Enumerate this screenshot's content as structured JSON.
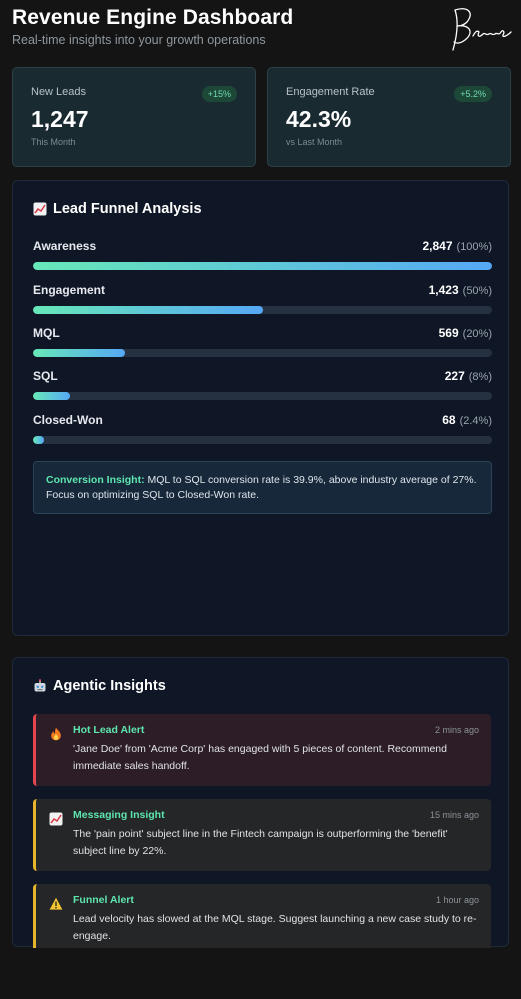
{
  "header": {
    "title": "Revenue Engine Dashboard",
    "subtitle": "Real-time insights into your growth operations",
    "signature": "Brand"
  },
  "kpis": [
    {
      "label": "New Leads",
      "value": "1,247",
      "caption": "This Month",
      "badge": "+15%"
    },
    {
      "label": "Engagement Rate",
      "value": "42.3%",
      "caption": "vs Last Month",
      "badge": "+5.2%"
    }
  ],
  "funnel": {
    "title": "Lead Funnel Analysis",
    "icon": "chart-icon",
    "stages": [
      {
        "name": "Awareness",
        "count": "2,847",
        "pct": "(100%)",
        "fill": 1.0
      },
      {
        "name": "Engagement",
        "count": "1,423",
        "pct": "(50%)",
        "fill": 0.5
      },
      {
        "name": "MQL",
        "count": "569",
        "pct": "(20%)",
        "fill": 0.2
      },
      {
        "name": "SQL",
        "count": "227",
        "pct": "(8%)",
        "fill": 0.08
      },
      {
        "name": "Closed-Won",
        "count": "68",
        "pct": "(2.4%)",
        "fill": 0.024
      }
    ],
    "insight_label": "Conversion Insight:",
    "insight_text": "MQL to SQL conversion rate is 39.9%, above industry average of 27%. Focus on optimizing SQL to Closed-Won rate."
  },
  "agentic": {
    "title": "Agentic Insights",
    "icon": "robot-icon",
    "alerts": [
      {
        "type": "hot",
        "icon": "fire-icon",
        "title": "Hot Lead Alert",
        "time": "2 mins ago",
        "text": "'Jane Doe' from 'Acme Corp' has engaged with 5 pieces of content. Recommend immediate sales handoff."
      },
      {
        "type": "info",
        "icon": "chart-icon",
        "title": "Messaging Insight",
        "time": "15 mins ago",
        "text": "The 'pain point' subject line in the Fintech campaign is outperforming the 'benefit' subject line by 22%."
      },
      {
        "type": "warn",
        "icon": "warning-icon",
        "title": "Funnel Alert",
        "time": "1 hour ago",
        "text": "Lead velocity has slowed at the MQL stage. Suggest launching a new case study to re-engage."
      }
    ]
  },
  "colors": {
    "accent_green": "#5ee6b0",
    "accent_blue": "#56a8f5",
    "hot_red": "#e2454f",
    "warn_yellow": "#e6b52a"
  }
}
